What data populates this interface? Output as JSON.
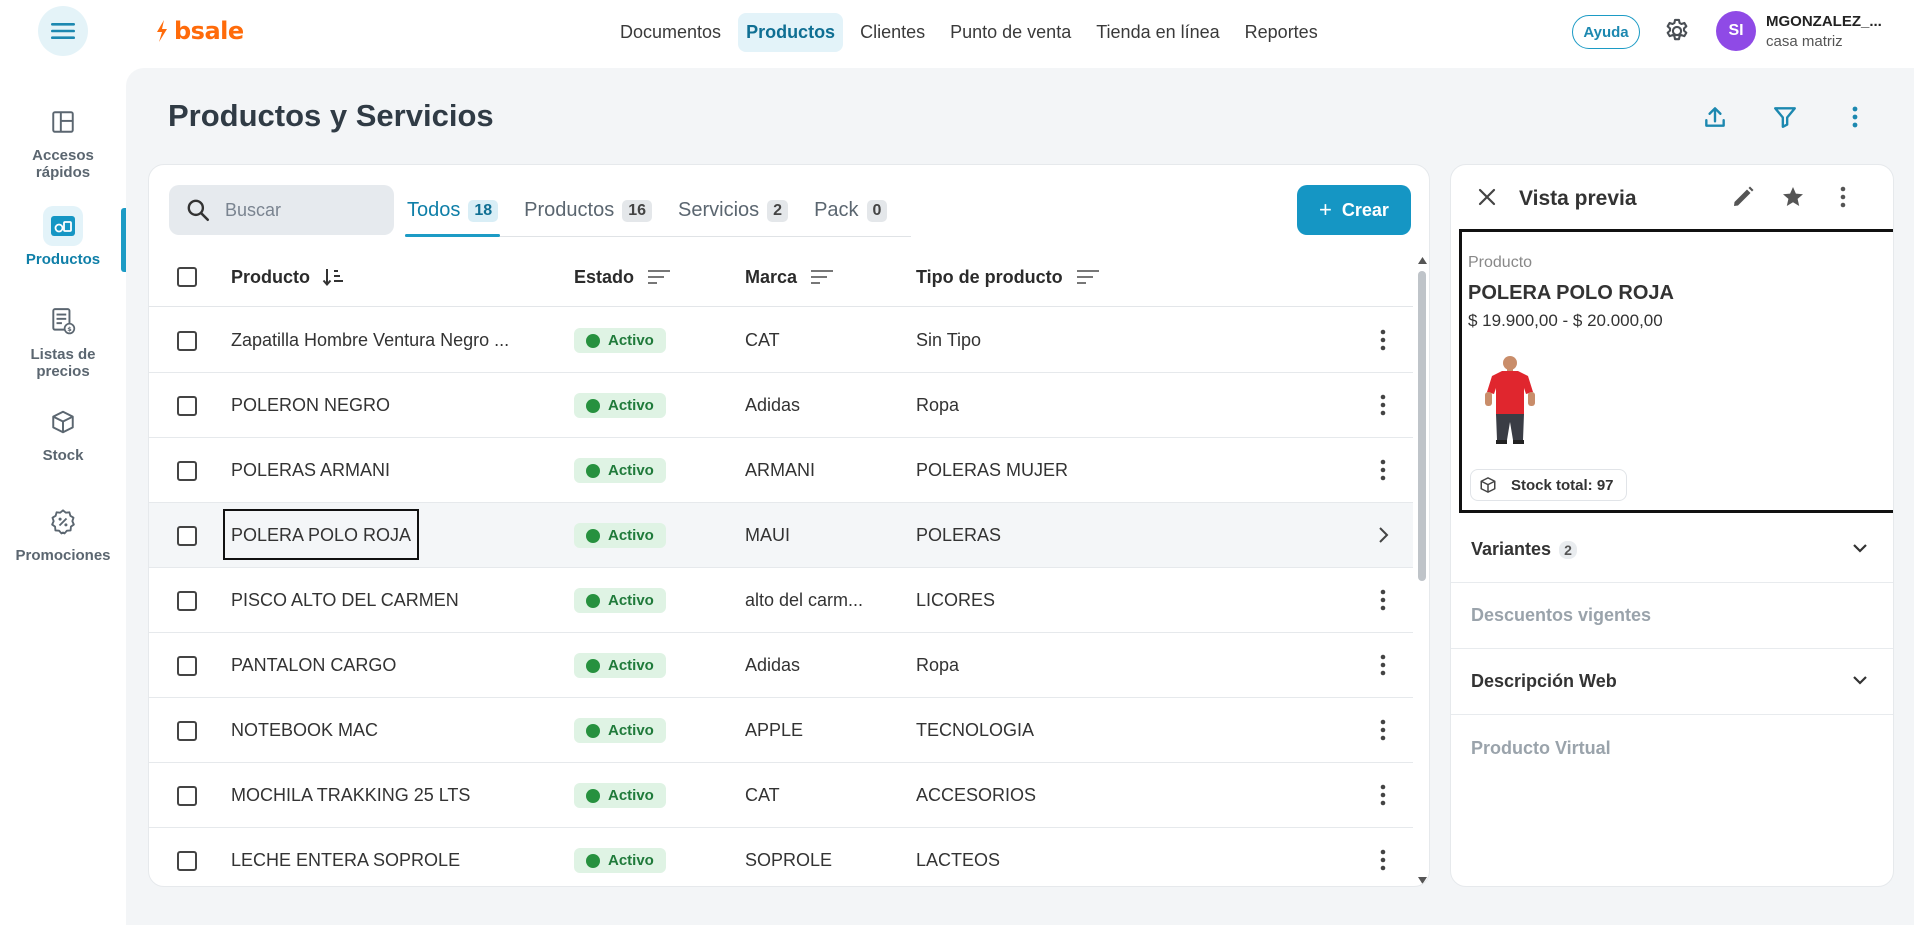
{
  "app": {
    "logo": "bsale",
    "nav": [
      "Documentos",
      "Productos",
      "Clientes",
      "Punto de venta",
      "Tienda en línea",
      "Reportes"
    ],
    "help_label": "Ayuda",
    "user_initials": "SI",
    "user_name": "MGONZALEZ_...",
    "user_branch": "casa matriz"
  },
  "sidebar": {
    "items": [
      {
        "label": "Accesos rápidos",
        "icon": "dashboard-icon"
      },
      {
        "label": "Productos",
        "icon": "products-icon"
      },
      {
        "label": "Listas de precios",
        "icon": "price-list-icon"
      },
      {
        "label": "Stock",
        "icon": "box-icon"
      },
      {
        "label": "Promociones",
        "icon": "promotion-icon"
      }
    ]
  },
  "page": {
    "title": "Productos y Servicios",
    "search_placeholder": "Buscar",
    "create_label": "Crear",
    "tabs": [
      {
        "label": "Todos",
        "count": "18"
      },
      {
        "label": "Productos",
        "count": "16"
      },
      {
        "label": "Servicios",
        "count": "2"
      },
      {
        "label": "Pack",
        "count": "0"
      }
    ],
    "columns": [
      "Producto",
      "Estado",
      "Marca",
      "Tipo de producto"
    ],
    "rows": [
      {
        "producto": "Zapatilla Hombre Ventura Negro ...",
        "estado": "Activo",
        "marca": "CAT",
        "tipo": "Sin Tipo"
      },
      {
        "producto": "POLERON NEGRO",
        "estado": "Activo",
        "marca": "Adidas",
        "tipo": "Ropa"
      },
      {
        "producto": "POLERAS ARMANI",
        "estado": "Activo",
        "marca": "ARMANI",
        "tipo": "POLERAS MUJER"
      },
      {
        "producto": "POLERA POLO ROJA",
        "estado": "Activo",
        "marca": "MAUI",
        "tipo": "POLERAS"
      },
      {
        "producto": "PISCO ALTO DEL CARMEN",
        "estado": "Activo",
        "marca": "alto del carm...",
        "tipo": "LICORES"
      },
      {
        "producto": "PANTALON CARGO",
        "estado": "Activo",
        "marca": "Adidas",
        "tipo": "Ropa"
      },
      {
        "producto": "NOTEBOOK MAC",
        "estado": "Activo",
        "marca": "APPLE",
        "tipo": "TECNOLOGIA"
      },
      {
        "producto": "MOCHILA TRAKKING 25 LTS",
        "estado": "Activo",
        "marca": "CAT",
        "tipo": "ACCESORIOS"
      },
      {
        "producto": "LECHE ENTERA SOPROLE",
        "estado": "Activo",
        "marca": "SOPROLE",
        "tipo": "LACTEOS"
      }
    ]
  },
  "preview": {
    "title": "Vista previa",
    "type": "Producto",
    "name": "POLERA POLO ROJA",
    "price": "$ 19.900,00 - $ 20.000,00",
    "stock": "Stock total: 97",
    "sections": [
      {
        "label": "Variantes",
        "count": "2"
      },
      {
        "label": "Descuentos vigentes"
      },
      {
        "label": "Descripción Web"
      },
      {
        "label": "Producto Virtual"
      }
    ]
  },
  "colors": {
    "accent": "#1596c4",
    "brand": "#ff6b0a",
    "status_active": "#27913f"
  }
}
